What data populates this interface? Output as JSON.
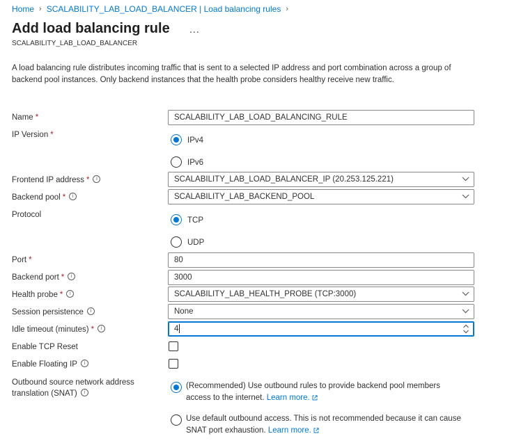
{
  "breadcrumb": {
    "items": [
      "Home",
      "SCALABILITY_LAB_LOAD_BALANCER | Load balancing rules"
    ]
  },
  "header": {
    "title": "Add load balancing rule",
    "more": "...",
    "subtitle": "SCALABILITY_LAB_LOAD_BALANCER"
  },
  "description": "A load balancing rule distributes incoming traffic that is sent to a selected IP address and port combination across a group of backend pool instances. Only backend instances that the health probe considers healthy receive new traffic.",
  "form": {
    "name": {
      "label": "Name",
      "required": "*",
      "value": "SCALABILITY_LAB_LOAD_BALANCING_RULE"
    },
    "ip_version": {
      "label": "IP Version",
      "required": "*",
      "options": [
        "IPv4",
        "IPv6"
      ],
      "selected": "IPv4"
    },
    "frontend_ip": {
      "label": "Frontend IP address",
      "required": "*",
      "value": "SCALABILITY_LAB_LOAD_BALANCER_IP (20.253.125.221)"
    },
    "backend_pool": {
      "label": "Backend pool",
      "required": "*",
      "value": "SCALABILITY_LAB_BACKEND_POOL"
    },
    "protocol": {
      "label": "Protocol",
      "options": [
        "TCP",
        "UDP"
      ],
      "selected": "TCP"
    },
    "port": {
      "label": "Port",
      "required": "*",
      "value": "80"
    },
    "backend_port": {
      "label": "Backend port",
      "required": "*",
      "value": "3000"
    },
    "health_probe": {
      "label": "Health probe",
      "required": "*",
      "value": "SCALABILITY_LAB_HEALTH_PROBE (TCP:3000)"
    },
    "session_persistence": {
      "label": "Session persistence",
      "value": "None"
    },
    "idle_timeout": {
      "label": "Idle timeout (minutes)",
      "required": "*",
      "value": "4"
    },
    "tcp_reset": {
      "label": "Enable TCP Reset",
      "checked": false
    },
    "floating_ip": {
      "label": "Enable Floating IP",
      "checked": false
    },
    "snat": {
      "label_line1": "Outbound source network address",
      "label_line2": "translation (SNAT)",
      "option1_line1": "(Recommended) Use outbound rules to provide backend pool members",
      "option1_line2": "access to the internet.",
      "option1_link": "Learn more.",
      "option2_line1": "Use default outbound access. This is not recommended because it can cause",
      "option2_line2": "SNAT port exhaustion.",
      "option2_link": "Learn more.",
      "selected": "option1"
    }
  },
  "info_glyph": "i",
  "colors": {
    "accent": "#0078d4",
    "required": "#a4262c",
    "text": "#323130",
    "border": "#8a8886"
  }
}
